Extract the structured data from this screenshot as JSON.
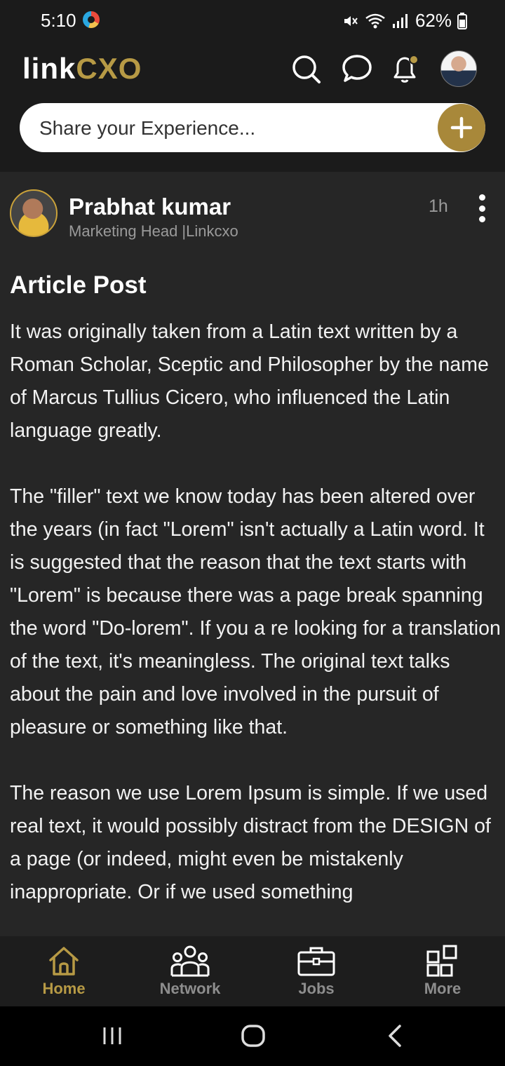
{
  "status_bar": {
    "time": "5:10",
    "battery": "62%"
  },
  "header": {
    "logo_part1": "link",
    "logo_part2": "CXO",
    "icons": [
      "search-icon",
      "chat-icon",
      "bell-icon",
      "avatar"
    ],
    "share_placeholder": "Share your Experience...",
    "accent_color": "#b79a45"
  },
  "post": {
    "author": "Prabhat kumar",
    "role": "Marketing Head |Linkcxo",
    "time": "1h",
    "title": "Article Post",
    "paragraphs": [
      "It was originally taken from a Latin text written by a Roman Scholar, Sceptic and Philosopher by the name of Marcus Tullius Cicero, who influenced the Latin language greatly.",
      "The \"filler\" text we know today has been altered over the years (in fact \"Lorem\" isn't actually a Latin word. It is suggested that the reason that the text starts with \"Lorem\" is because there was a page break spanning the word \"Do-lorem\". If you a re looking for a translation of the text, it's meaningless. The original text talks about the pain and love involved in the pursuit of pleasure or something like that.",
      "The reason we use Lorem Ipsum is simple. If we used real text, it would possibly distract from the DESIGN of a page (or indeed, might even be mistakenly inappropriate. Or if we used something"
    ]
  },
  "bottom_nav": [
    {
      "label": "Home",
      "icon": "home-icon",
      "active": true
    },
    {
      "label": "Network",
      "icon": "people-icon",
      "active": false
    },
    {
      "label": "Jobs",
      "icon": "briefcase-icon",
      "active": false
    },
    {
      "label": "More",
      "icon": "grid-icon",
      "active": false
    }
  ]
}
